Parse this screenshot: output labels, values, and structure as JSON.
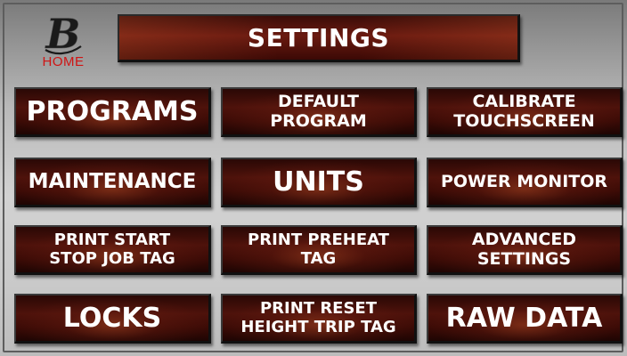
{
  "home": {
    "label": "HOME",
    "logo_letter": "B",
    "logo_icon": "b-logo-icon"
  },
  "title": "SETTINGS",
  "buttons": {
    "programs": "PROGRAMS",
    "default_program": "DEFAULT\nPROGRAM",
    "calibrate_touchscreen": "CALIBRATE\nTOUCHSCREEN",
    "maintenance": "MAINTENANCE",
    "units": "UNITS",
    "power_monitor": "POWER MONITOR",
    "print_start_stop_job_tag": "PRINT START\nSTOP JOB TAG",
    "print_preheat_tag": "PRINT PREHEAT\nTAG",
    "advanced_settings": "ADVANCED\nSETTINGS",
    "locks": "LOCKS",
    "print_reset_height_trip_tag": "PRINT RESET\nHEIGHT TRIP TAG",
    "raw_data": "RAW DATA"
  },
  "colors": {
    "button_dark": "#2a0805",
    "button_glow": "#aa4623",
    "home_label": "#d01414",
    "text": "#ffffff"
  }
}
